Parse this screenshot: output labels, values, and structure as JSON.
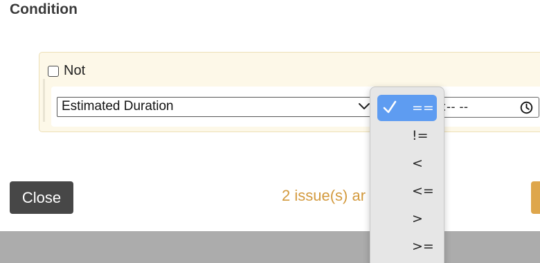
{
  "dialog": {
    "title": "Condition"
  },
  "condition": {
    "not_label": "Not",
    "field_value": "Estimated Duration",
    "time_placeholder": "-:-- --"
  },
  "operator_menu": {
    "selected": "==",
    "options": [
      "==",
      "!=",
      "<",
      "<=",
      ">",
      ">="
    ]
  },
  "footer": {
    "close_label": "Close",
    "warning_text": "2 issue(s) ar      ting saving"
  },
  "colors": {
    "accent": "#5e9cf1",
    "warning": "#d39a3e",
    "panel_bg": "#fdf8e8",
    "close_bg": "#474747"
  }
}
